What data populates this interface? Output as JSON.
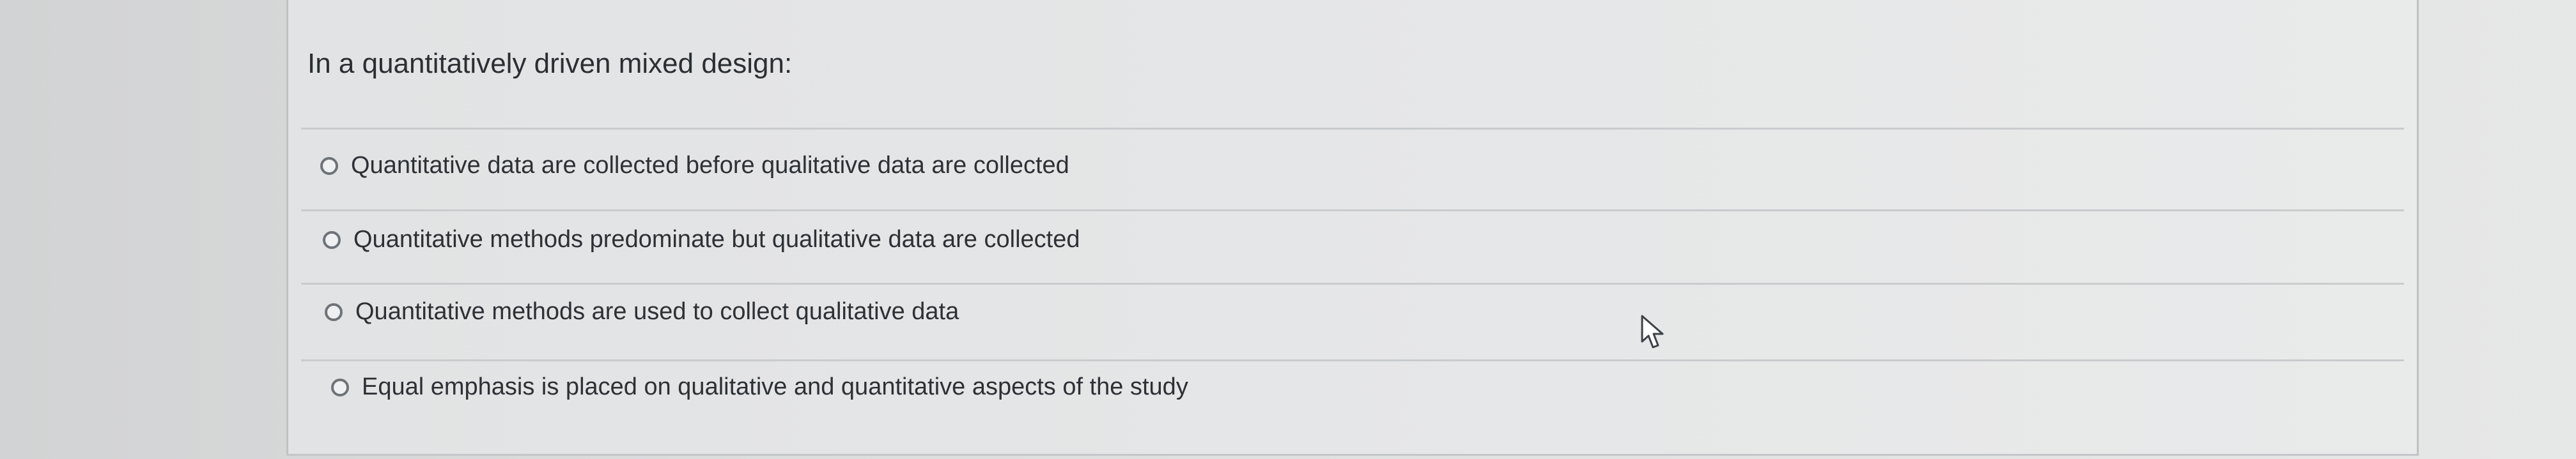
{
  "question": {
    "prompt": "In a quantitatively driven mixed design:",
    "options": [
      {
        "label": "Quantitative data are collected before qualitative data are collected",
        "selected": false
      },
      {
        "label": "Quantitative methods predominate but qualitative data are collected",
        "selected": false
      },
      {
        "label": "Quantitative methods are used to collect qualitative data",
        "selected": false
      },
      {
        "label": "Equal emphasis is placed on qualitative and quantitative aspects of the study",
        "selected": false
      }
    ]
  },
  "cursor": {
    "icon": "mouse-pointer-icon"
  },
  "colors": {
    "background": "#d9dadb",
    "card": "#e5e6e7",
    "text": "#2b2f33",
    "radio_border": "#6e7378"
  }
}
